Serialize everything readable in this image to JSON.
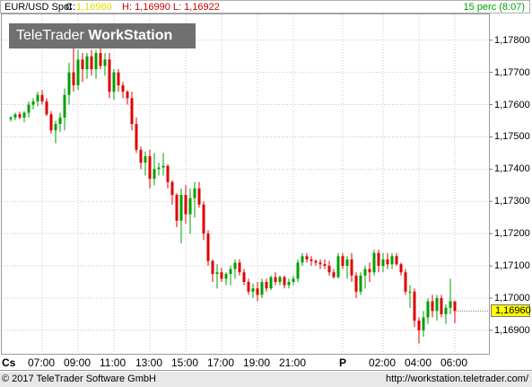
{
  "header": {
    "symbol": "EUR/USD Spot",
    "close_label": "C:",
    "close_value": "1,16960",
    "high_label": "H:",
    "high_value": "1,16990",
    "low_label": "L:",
    "low_value": "1,16922",
    "period": "15 perc (8:07)"
  },
  "watermark": {
    "brand": "TeleTrader",
    "product": "WorkStation"
  },
  "footer": {
    "copyright": "© 2017  TeleTrader Software GmbH",
    "url": "http://workstation.teletrader.com/"
  },
  "x_axis_mode": "Cs",
  "current_price": "1,16960",
  "colors": {
    "up": "#00a000",
    "down": "#e00000",
    "grid": "#c8c8c8",
    "price_box": "#ffff00"
  },
  "chart_data": {
    "type": "candlestick",
    "title": "EUR/USD Spot",
    "interval": "15 perc",
    "ylim": [
      1.1683,
      1.1788
    ],
    "y_ticks": [
      "1,17800",
      "1,17700",
      "1,17600",
      "1,17500",
      "1,17400",
      "1,17300",
      "1,17200",
      "1,17100",
      "1,17000",
      "1,16900"
    ],
    "x_ticks": [
      {
        "label": "Cs",
        "index": 0
      },
      {
        "label": "07:00",
        "index": 7
      },
      {
        "label": "09:00",
        "index": 15
      },
      {
        "label": "11:00",
        "index": 23
      },
      {
        "label": "13:00",
        "index": 31
      },
      {
        "label": "15:00",
        "index": 39
      },
      {
        "label": "17:00",
        "index": 47
      },
      {
        "label": "19:00",
        "index": 55
      },
      {
        "label": "21:00",
        "index": 63
      },
      {
        "label": "P",
        "index": 74
      },
      {
        "label": "02:00",
        "index": 83
      },
      {
        "label": "04:00",
        "index": 91
      },
      {
        "label": "06:00",
        "index": 99
      }
    ],
    "candles": [
      [
        1.17555,
        1.17565,
        1.17548,
        1.1756
      ],
      [
        1.1756,
        1.17575,
        1.17552,
        1.1757
      ],
      [
        1.1757,
        1.17578,
        1.17555,
        1.1756
      ],
      [
        1.1756,
        1.1758,
        1.17545,
        1.17575
      ],
      [
        1.17575,
        1.1761,
        1.1756,
        1.176
      ],
      [
        1.176,
        1.1762,
        1.17585,
        1.1761
      ],
      [
        1.1761,
        1.1764,
        1.17595,
        1.1763
      ],
      [
        1.1763,
        1.17645,
        1.176,
        1.1761
      ],
      [
        1.1761,
        1.1762,
        1.17565,
        1.1757
      ],
      [
        1.1757,
        1.1758,
        1.1751,
        1.1752
      ],
      [
        1.1752,
        1.1755,
        1.1748,
        1.1754
      ],
      [
        1.1754,
        1.17575,
        1.17515,
        1.1756
      ],
      [
        1.1756,
        1.1765,
        1.1752,
        1.1763
      ],
      [
        1.1763,
        1.1773,
        1.176,
        1.177
      ],
      [
        1.177,
        1.178,
        1.1764,
        1.1766
      ],
      [
        1.1766,
        1.1777,
        1.17645,
        1.1774
      ],
      [
        1.1774,
        1.1776,
        1.1767,
        1.1771
      ],
      [
        1.1771,
        1.1776,
        1.1768,
        1.1775
      ],
      [
        1.1775,
        1.1777,
        1.1769,
        1.1771
      ],
      [
        1.1771,
        1.1777,
        1.1768,
        1.1776
      ],
      [
        1.1776,
        1.1778,
        1.1771,
        1.1772
      ],
      [
        1.1772,
        1.1776,
        1.1769,
        1.1774
      ],
      [
        1.1774,
        1.1776,
        1.1762,
        1.1764
      ],
      [
        1.1764,
        1.1771,
        1.17615,
        1.177
      ],
      [
        1.177,
        1.1771,
        1.1764,
        1.1766
      ],
      [
        1.1766,
        1.1767,
        1.1762,
        1.1764
      ],
      [
        1.1764,
        1.17645,
        1.176,
        1.1762
      ],
      [
        1.1762,
        1.1764,
        1.1752,
        1.1754
      ],
      [
        1.1754,
        1.1756,
        1.1745,
        1.1746
      ],
      [
        1.1746,
        1.1747,
        1.174,
        1.1742
      ],
      [
        1.1742,
        1.17455,
        1.1738,
        1.1744
      ],
      [
        1.1744,
        1.1746,
        1.1734,
        1.1737
      ],
      [
        1.1737,
        1.1745,
        1.1735,
        1.174
      ],
      [
        1.174,
        1.1742,
        1.1738,
        1.17405
      ],
      [
        1.17405,
        1.1745,
        1.1738,
        1.1741
      ],
      [
        1.1741,
        1.17415,
        1.1734,
        1.1736
      ],
      [
        1.1736,
        1.17365,
        1.1729,
        1.1732
      ],
      [
        1.1732,
        1.17325,
        1.1722,
        1.1724
      ],
      [
        1.1724,
        1.1734,
        1.1717,
        1.1732
      ],
      [
        1.1732,
        1.1735,
        1.1723,
        1.1726
      ],
      [
        1.1726,
        1.1734,
        1.172,
        1.1731
      ],
      [
        1.1731,
        1.1736,
        1.1725,
        1.1734
      ],
      [
        1.1734,
        1.1736,
        1.1728,
        1.1729
      ],
      [
        1.1729,
        1.173,
        1.1718,
        1.172
      ],
      [
        1.172,
        1.1721,
        1.171,
        1.17115
      ],
      [
        1.17115,
        1.1712,
        1.1705,
        1.17075
      ],
      [
        1.17075,
        1.17105,
        1.1703,
        1.1708
      ],
      [
        1.1708,
        1.17095,
        1.1705,
        1.1706
      ],
      [
        1.1706,
        1.1708,
        1.1704,
        1.17075
      ],
      [
        1.17075,
        1.171,
        1.1704,
        1.1709
      ],
      [
        1.1709,
        1.1712,
        1.1706,
        1.1711
      ],
      [
        1.1711,
        1.1712,
        1.1707,
        1.1708
      ],
      [
        1.1708,
        1.1709,
        1.1704,
        1.1705
      ],
      [
        1.1705,
        1.1706,
        1.1701,
        1.1702
      ],
      [
        1.1702,
        1.17045,
        1.17,
        1.1703
      ],
      [
        1.1703,
        1.1705,
        1.1699,
        1.1701
      ],
      [
        1.1701,
        1.1706,
        1.17,
        1.1705
      ],
      [
        1.1705,
        1.1706,
        1.1702,
        1.1703
      ],
      [
        1.1703,
        1.1707,
        1.17025,
        1.17065
      ],
      [
        1.17065,
        1.1708,
        1.1704,
        1.1705
      ],
      [
        1.1705,
        1.1707,
        1.1704,
        1.17065
      ],
      [
        1.17065,
        1.1707,
        1.1703,
        1.1704
      ],
      [
        1.1704,
        1.1706,
        1.1703,
        1.1705
      ],
      [
        1.1705,
        1.1707,
        1.1704,
        1.1706
      ],
      [
        1.1706,
        1.1712,
        1.1705,
        1.1711
      ],
      [
        1.1711,
        1.1714,
        1.171,
        1.1713
      ],
      [
        1.1713,
        1.1714,
        1.1711,
        1.1712
      ],
      [
        1.1712,
        1.1713,
        1.171,
        1.17115
      ],
      [
        1.17115,
        1.1712,
        1.171,
        1.1711
      ],
      [
        1.1711,
        1.1712,
        1.1709,
        1.17105
      ],
      [
        1.17105,
        1.1712,
        1.1709,
        1.171
      ],
      [
        1.171,
        1.17115,
        1.1707,
        1.1708
      ],
      [
        1.1708,
        1.1709,
        1.1706,
        1.17065
      ],
      [
        1.17065,
        1.1714,
        1.1706,
        1.1713
      ],
      [
        1.1713,
        1.1714,
        1.1709,
        1.171
      ],
      [
        1.171,
        1.1713,
        1.1706,
        1.1712
      ],
      [
        1.1712,
        1.1714,
        1.1705,
        1.1707
      ],
      [
        1.1707,
        1.1708,
        1.17,
        1.1702
      ],
      [
        1.1702,
        1.1708,
        1.1701,
        1.1707
      ],
      [
        1.1707,
        1.171,
        1.1703,
        1.1709
      ],
      [
        1.1709,
        1.1711,
        1.1705,
        1.1708
      ],
      [
        1.1708,
        1.1715,
        1.1707,
        1.1714
      ],
      [
        1.1714,
        1.1715,
        1.1708,
        1.171
      ],
      [
        1.171,
        1.1714,
        1.1708,
        1.1712
      ],
      [
        1.1712,
        1.1714,
        1.1709,
        1.17105
      ],
      [
        1.17105,
        1.1714,
        1.1709,
        1.1713
      ],
      [
        1.1713,
        1.1714,
        1.171,
        1.17105
      ],
      [
        1.17105,
        1.1711,
        1.1707,
        1.1708
      ],
      [
        1.1708,
        1.1709,
        1.1701,
        1.1702
      ],
      [
        1.1702,
        1.1704,
        1.1697,
        1.1702
      ],
      [
        1.1702,
        1.1703,
        1.1691,
        1.1693
      ],
      [
        1.1693,
        1.1694,
        1.1686,
        1.169
      ],
      [
        1.169,
        1.1696,
        1.1688,
        1.1694
      ],
      [
        1.1694,
        1.17,
        1.1692,
        1.1699
      ],
      [
        1.1699,
        1.1701,
        1.1694,
        1.1696
      ],
      [
        1.1696,
        1.1701,
        1.1693,
        1.17
      ],
      [
        1.17,
        1.1701,
        1.1694,
        1.1695
      ],
      [
        1.1695,
        1.1698,
        1.1692,
        1.1697
      ],
      [
        1.1697,
        1.1706,
        1.1695,
        1.1699
      ],
      [
        1.1699,
        1.1699,
        1.16922,
        1.1696
      ]
    ]
  }
}
